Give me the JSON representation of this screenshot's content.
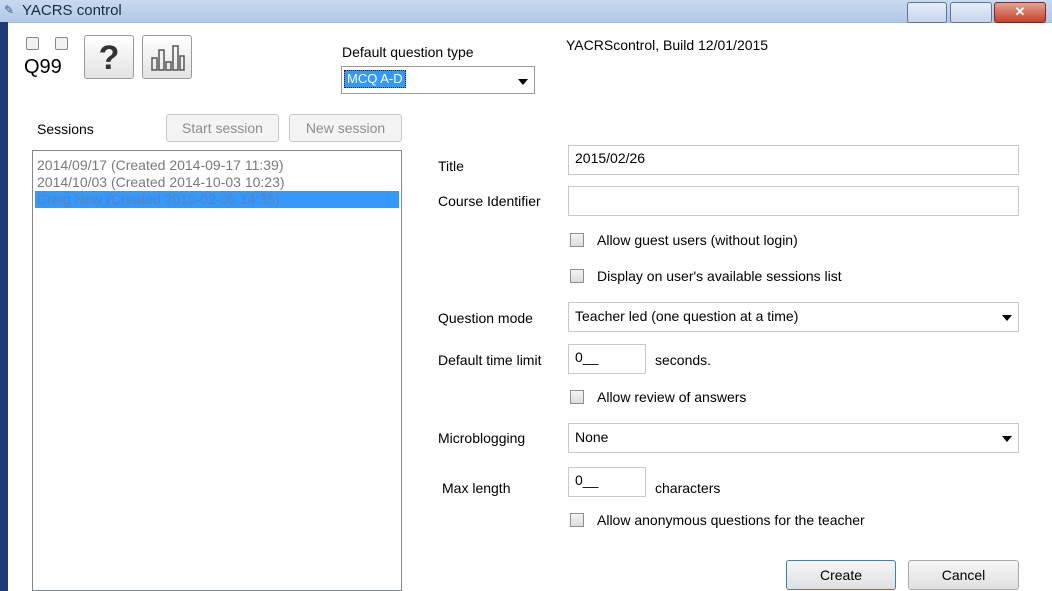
{
  "window": {
    "title": "YACRS control"
  },
  "toolbar": {
    "question_number": "Q99",
    "help_icon": "question-mark-icon",
    "stats_icon": "bar-chart-icon"
  },
  "default_question_type": {
    "label": "Default question type",
    "value": "MCQ A-D"
  },
  "build_info": "YACRScontrol, Build 12/01/2015",
  "sessions": {
    "label": "Sessions",
    "start_label": "Start session",
    "new_label": "New session",
    "items": [
      {
        "label": "2014/09/17 (Created 2014-09-17 11:39)",
        "selected": false
      },
      {
        "label": "2014/10/03 (Created 2014-10-03 10:23)",
        "selected": false
      },
      {
        "label": "Craig New (Created 2015-02-05 14:35)",
        "selected": true
      }
    ]
  },
  "form": {
    "title_label": "Title",
    "title_value": "2015/02/26",
    "course_label": "Course Identifier",
    "course_value": "",
    "allow_guest_label": "Allow guest users (without login)",
    "display_sessions_label": "Display on user's available sessions list",
    "question_mode_label": "Question mode",
    "question_mode_value": "Teacher led (one question at a time)",
    "time_limit_label": "Default time limit",
    "time_limit_value": "0__",
    "time_limit_unit": "seconds.",
    "allow_review_label": "Allow review of answers",
    "microblogging_label": "Microblogging",
    "microblogging_value": "None",
    "max_length_label": "Max length",
    "max_length_value": "0__",
    "max_length_unit": "characters",
    "allow_anon_label": "Allow anonymous questions for the teacher",
    "create_label": "Create",
    "cancel_label": "Cancel"
  }
}
